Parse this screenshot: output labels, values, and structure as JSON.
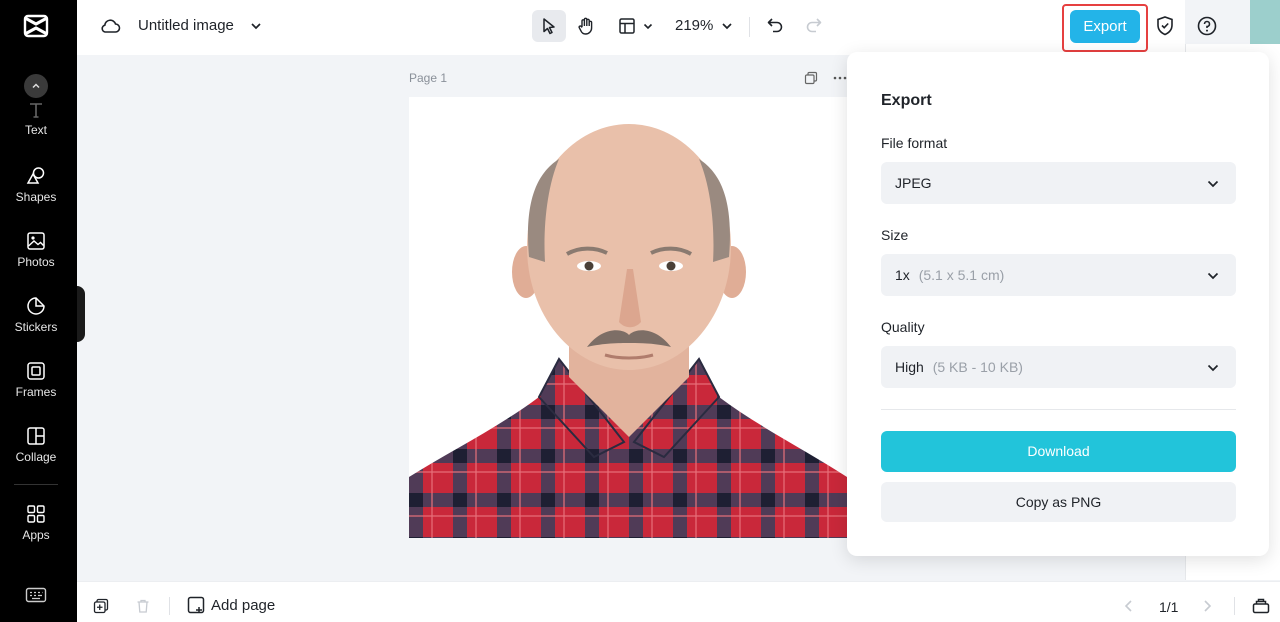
{
  "app": {
    "logo_icon": "capcut-logo-icon"
  },
  "sidebar": {
    "items": [
      {
        "label": "Text",
        "icon": "text-icon"
      },
      {
        "label": "Shapes",
        "icon": "shapes-icon"
      },
      {
        "label": "Photos",
        "icon": "photo-icon"
      },
      {
        "label": "Stickers",
        "icon": "sticker-icon"
      },
      {
        "label": "Frames",
        "icon": "frame-icon"
      },
      {
        "label": "Collage",
        "icon": "collage-icon"
      },
      {
        "label": "Apps",
        "icon": "apps-grid-icon"
      }
    ]
  },
  "header": {
    "title": "Untitled image",
    "zoom": "219%",
    "export_label": "Export"
  },
  "canvas": {
    "page_label": "Page 1"
  },
  "export_panel": {
    "title": "Export",
    "file_format_label": "File format",
    "file_format_value": "JPEG",
    "size_label": "Size",
    "size_value": "1x",
    "size_hint": "(5.1 x 5.1 cm)",
    "quality_label": "Quality",
    "quality_value": "High",
    "quality_hint": "(5 KB - 10 KB)",
    "download_label": "Download",
    "copy_label": "Copy as PNG"
  },
  "footer": {
    "add_page_label": "Add page",
    "page_counter": "1/1"
  },
  "colors": {
    "export_button": "#23b4e8",
    "download_button": "#22c4da",
    "highlight_border": "#e64040"
  }
}
